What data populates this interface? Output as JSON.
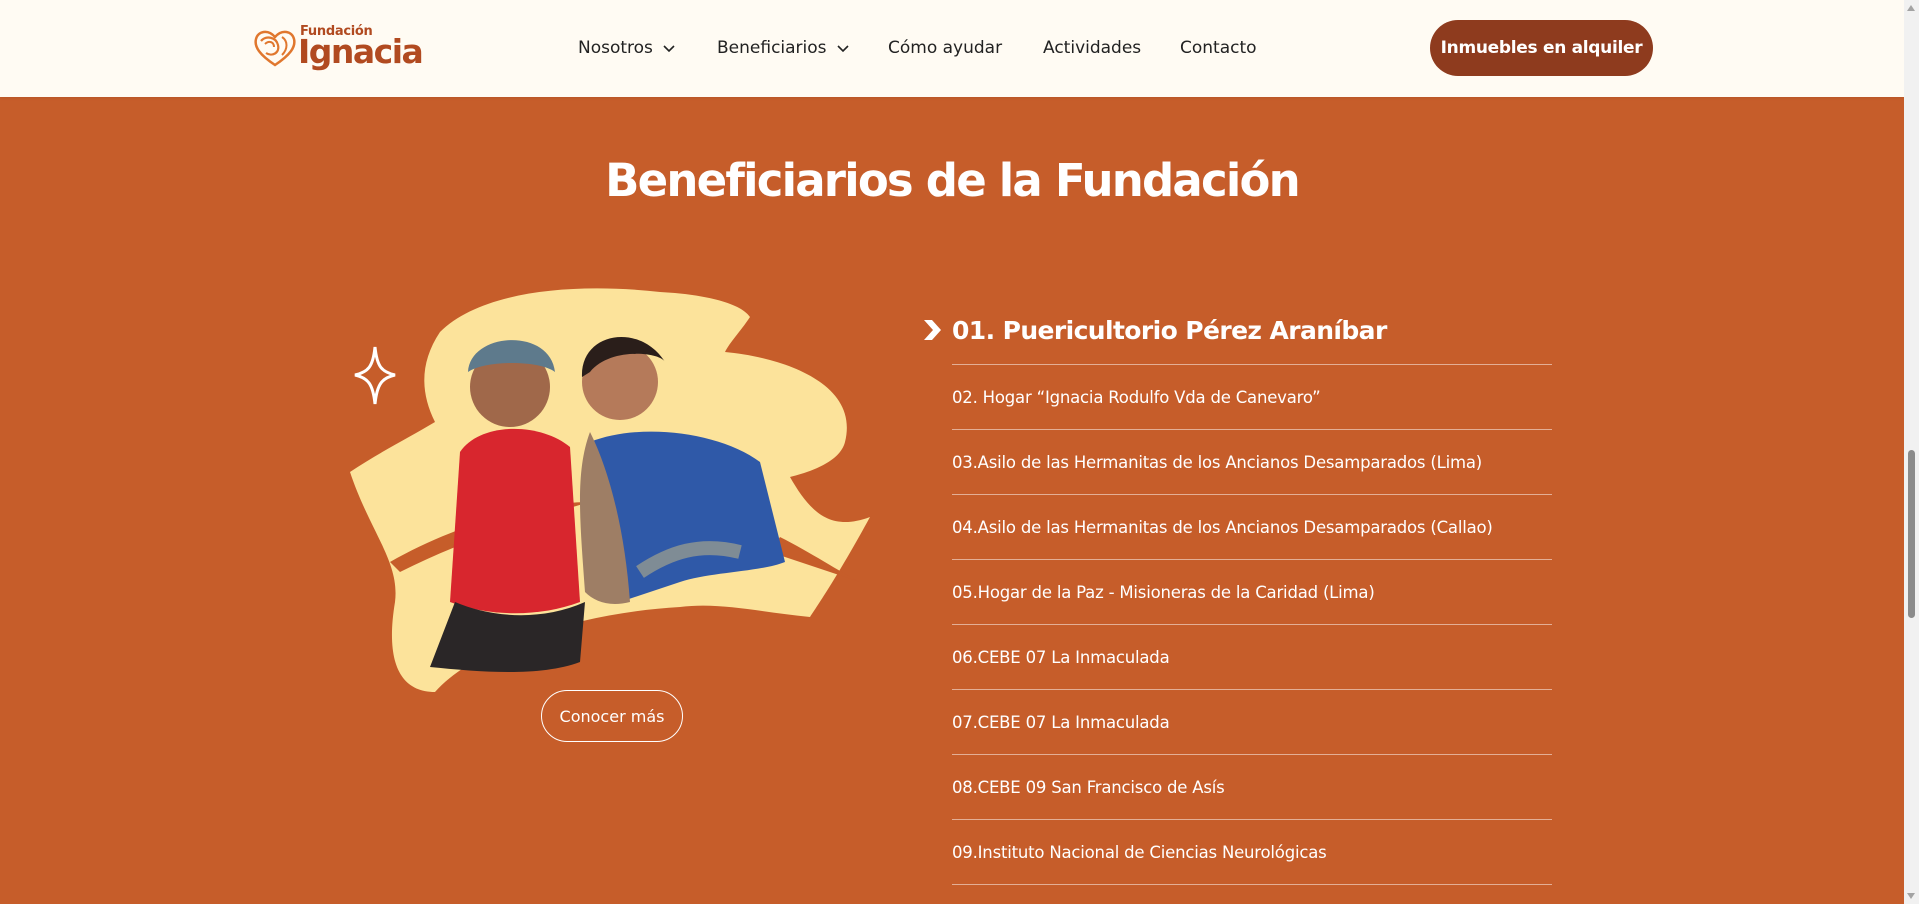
{
  "logo": {
    "small": "Fundación",
    "big": "Ignacia"
  },
  "nav": {
    "items": [
      {
        "label": "Nosotros",
        "has_dropdown": true
      },
      {
        "label": "Beneficiarios",
        "has_dropdown": true
      },
      {
        "label": "Cómo ayudar",
        "has_dropdown": false
      },
      {
        "label": "Actividades",
        "has_dropdown": false
      },
      {
        "label": "Contacto",
        "has_dropdown": false
      }
    ],
    "cta_label": "Inmuebles en alquiler"
  },
  "main": {
    "title": "Beneficiarios de la Fundación",
    "more_button": "Conocer más",
    "active_item": "01. Puericultorio Pérez Araníbar",
    "items": [
      "02. Hogar “Ignacia Rodulfo Vda de Canevaro”",
      "03.Asilo de las Hermanitas de los Ancianos Desamparados (Lima)",
      "04.Asilo de las Hermanitas de los Ancianos Desamparados (Callao)",
      "05.Hogar de la Paz - Misioneras de la Caridad (Lima)",
      "06.CEBE 07 La Inmaculada",
      "07.CEBE 07 La Inmaculada",
      "08.CEBE 09 San Francisco de Asís",
      "09.Instituto Nacional de Ciencias Neurológicas"
    ]
  },
  "icons": {
    "logo_mark": "heart-swirl-icon",
    "dropdown": "chevron-down-icon",
    "active_marker": "arrow-right-icon",
    "decoration": "sparkle-icon"
  },
  "colors": {
    "background": "#C65D2A",
    "header": "#FFFBF3",
    "brand": "#B14A20",
    "cta": "#8E3B1E",
    "blob": "#FCE39B"
  }
}
